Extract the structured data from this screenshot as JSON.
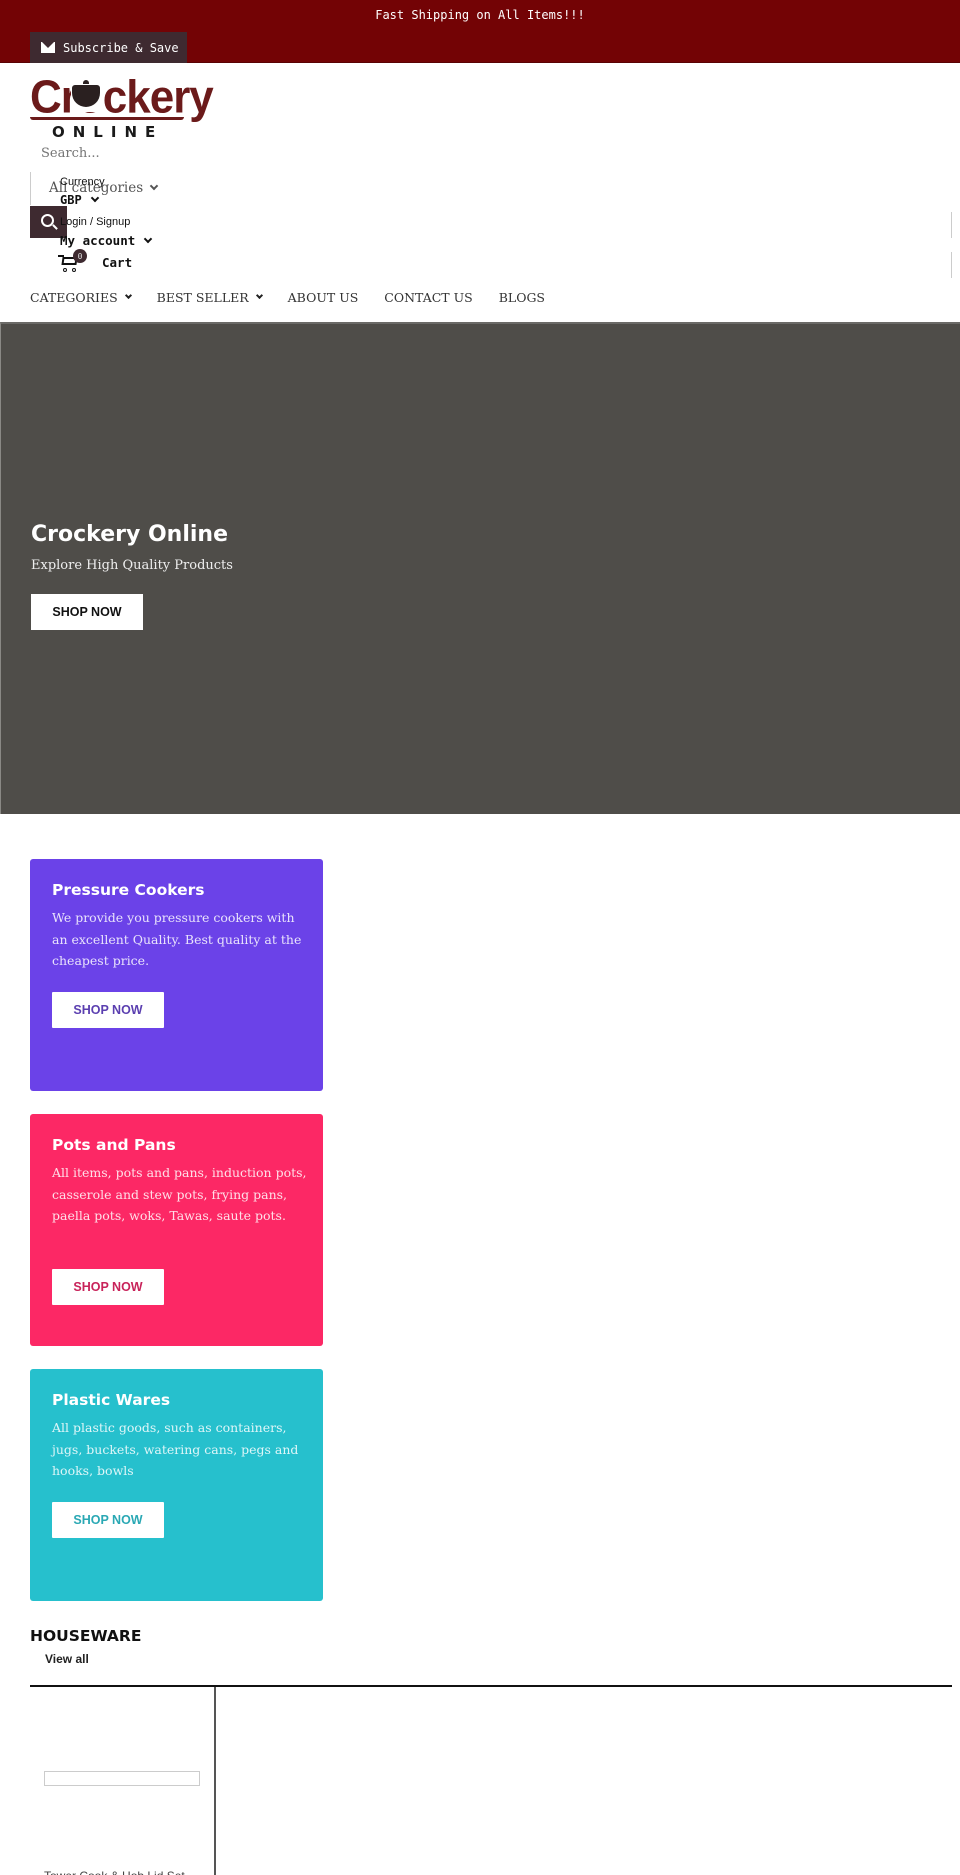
{
  "announcement": {
    "message": "Fast Shipping on All Items!!!",
    "subscribe_label": "Subscribe & Save",
    "background": "#730305"
  },
  "logo": {
    "word": "Crockery",
    "sub": "ONLINE",
    "color": "#6b1a1a"
  },
  "search": {
    "placeholder": "Search...",
    "category_selected": "All categories"
  },
  "header": {
    "currency_label": "Currency",
    "currency_value": "GBP",
    "login_label": "Login / Signup",
    "account_label": "My account",
    "cart_label": "Cart",
    "cart_count": "0"
  },
  "nav": {
    "items": [
      {
        "label": "CATEGORIES",
        "has_dropdown": true
      },
      {
        "label": "BEST SELLER",
        "has_dropdown": true
      },
      {
        "label": "ABOUT US",
        "has_dropdown": false
      },
      {
        "label": "CONTACT US",
        "has_dropdown": false
      },
      {
        "label": "BLOGS",
        "has_dropdown": false
      }
    ]
  },
  "hero": {
    "title": "Crockery Online",
    "subtitle": "Explore High Quality Products",
    "button_label": "SHOP NOW",
    "background": "#4f4d49"
  },
  "cards": [
    {
      "title": "Pressure Cookers",
      "description": "We provide you pressure cookers with an excellent Quality. Best quality at the cheapest price.",
      "button_label": "SHOP NOW",
      "color": "#6b42e8",
      "button_text_color": "#5b3fb0"
    },
    {
      "title": "Pots and Pans",
      "description": "All items, pots and pans, induction pots, casserole and stew pots, frying pans, paella pots, woks, Tawas, saute pots.",
      "button_label": "SHOP NOW",
      "color": "#fc2865",
      "button_text_color": "#c8235a"
    },
    {
      "title": "Plastic Wares",
      "description": "All plastic goods, such as containers, jugs, buckets, watering cans, pegs and hooks, bowls",
      "button_label": "SHOP NOW",
      "color": "#26c0cd",
      "button_text_color": "#2aa8b4"
    }
  ],
  "houseware": {
    "title": "HOUSEWARE",
    "view_all_label": "View all",
    "first_product_title_partial": "Tower Cook & Hob Lid Set"
  }
}
